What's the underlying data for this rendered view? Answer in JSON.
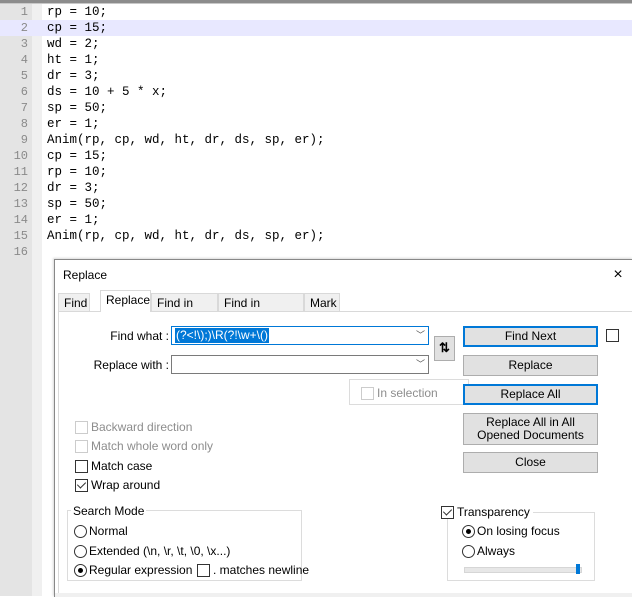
{
  "editor": {
    "current_line": 2,
    "lines": [
      {
        "num": "1",
        "code": "rp = 10;"
      },
      {
        "num": "2",
        "code": "cp = 15;"
      },
      {
        "num": "3",
        "code": "wd = 2;"
      },
      {
        "num": "4",
        "code": "ht = 1;"
      },
      {
        "num": "5",
        "code": "dr = 3;"
      },
      {
        "num": "6",
        "code": "ds = 10 + 5 * x;"
      },
      {
        "num": "7",
        "code": "sp = 50;"
      },
      {
        "num": "8",
        "code": "er = 1;"
      },
      {
        "num": "9",
        "code": "Anim(rp, cp, wd, ht, dr, ds, sp, er);"
      },
      {
        "num": "10",
        "code": "cp = 15;"
      },
      {
        "num": "11",
        "code": "rp = 10;"
      },
      {
        "num": "12",
        "code": "dr = 3;"
      },
      {
        "num": "13",
        "code": "sp = 50;"
      },
      {
        "num": "14",
        "code": "er = 1;"
      },
      {
        "num": "15",
        "code": "Anim(rp, cp, wd, ht, dr, ds, sp, er);"
      },
      {
        "num": "16",
        "code": ""
      }
    ]
  },
  "dialog": {
    "title": "Replace",
    "close_icon": "×",
    "tabs": [
      {
        "label": "Find",
        "active": false
      },
      {
        "label": "Replace",
        "active": true
      },
      {
        "label": "Find in Files",
        "active": false
      },
      {
        "label": "Find in Projects",
        "active": false
      },
      {
        "label": "Mark",
        "active": false
      }
    ],
    "find_what_label": "Find what :",
    "find_what_value": "(?<!\\);)\\R(?!\\w+\\()",
    "replace_with_label": "Replace with :",
    "replace_with_value": "",
    "dropdown_arrow": "﹀",
    "swap_icon": "⇅",
    "in_selection_label": "In selection",
    "buttons": {
      "find_next": "Find Next",
      "replace": "Replace",
      "replace_all": "Replace All",
      "replace_all_opened": "Replace All in All Opened Documents",
      "close": "Close"
    },
    "options": [
      {
        "label": "Backward direction",
        "checked": false,
        "disabled": true
      },
      {
        "label": "Match whole word only",
        "checked": false,
        "disabled": true
      },
      {
        "label": "Match case",
        "checked": false,
        "disabled": false
      },
      {
        "label": "Wrap around",
        "checked": true,
        "disabled": false
      }
    ],
    "search_mode": {
      "title": "Search Mode",
      "modes": [
        {
          "label": "Normal",
          "selected": false
        },
        {
          "label": "Extended (\\n, \\r, \\t, \\0, \\x...)",
          "selected": false
        },
        {
          "label": "Regular expression",
          "selected": true
        }
      ],
      "matches_newline_label": ". matches newline",
      "matches_newline_checked": false
    },
    "transparency": {
      "label": "Transparency",
      "checked": true,
      "modes": [
        {
          "label": "On losing focus",
          "selected": true
        },
        {
          "label": "Always",
          "selected": false
        }
      ],
      "level_percent": 100
    }
  }
}
